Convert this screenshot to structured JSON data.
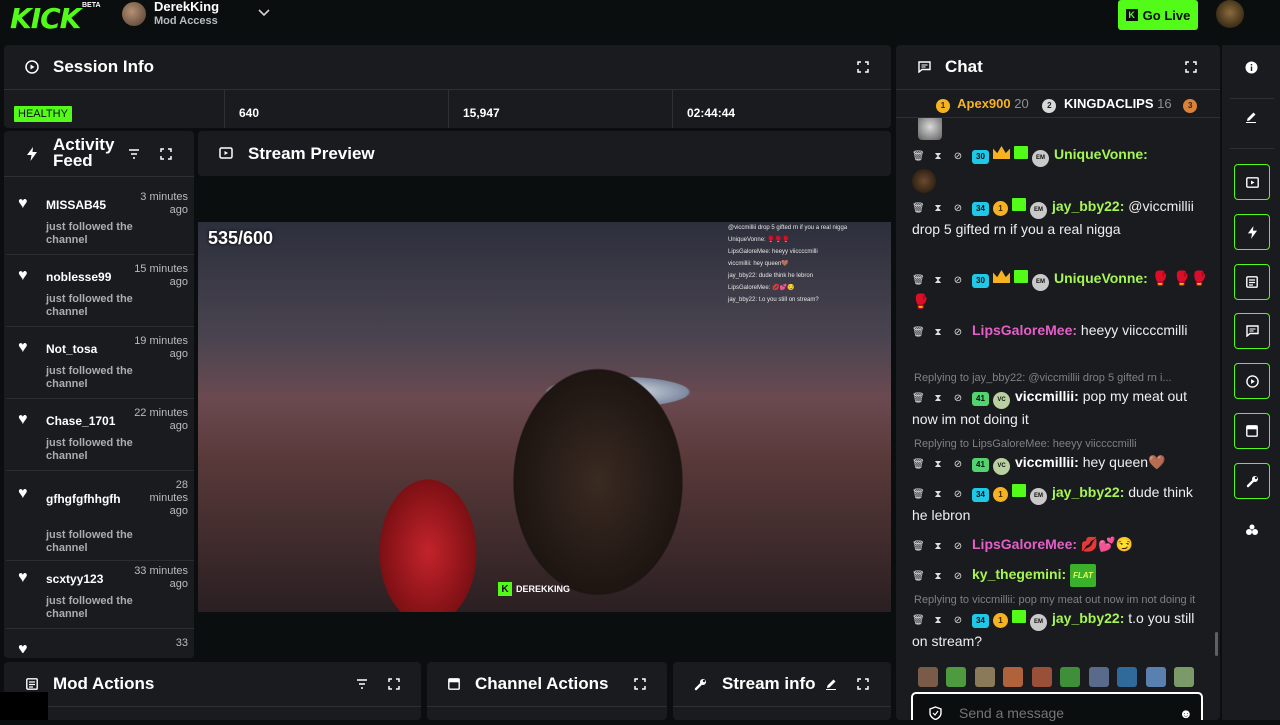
{
  "header": {
    "logo": "KICK",
    "beta": "BETA",
    "username": "DerekKing",
    "role": "Mod Access",
    "go_live": "Go Live",
    "go_live_icon": "K"
  },
  "session": {
    "title": "Session Info",
    "status": "HEALTHY",
    "viewers": "640",
    "followers": "15,947",
    "uptime": "02:44:44"
  },
  "activity": {
    "title": "Activity Feed",
    "items": [
      {
        "name": "MISSAB45",
        "time": "3 minutes ago",
        "action": "just followed the channel"
      },
      {
        "name": "noblesse99",
        "time": "15 minutes ago",
        "action": "just followed the channel"
      },
      {
        "name": "Not_tosa",
        "time": "19 minutes ago",
        "action": "just followed the channel"
      },
      {
        "name": "Chase_1701",
        "time": "22 minutes ago",
        "action": "just followed the channel"
      },
      {
        "name": "gfhgfgfhhgfh",
        "time": "28 minutes ago",
        "action": "just followed the channel"
      },
      {
        "name": "scxtyy123",
        "time": "33 minutes ago",
        "action": "just followed the channel"
      },
      {
        "name": "",
        "time": "33",
        "action": ""
      }
    ]
  },
  "stream": {
    "title": "Stream Preview",
    "count": "535/600",
    "watermark": "DEREKKING",
    "watermark_icon": "K",
    "overlay_lines": [
      "@viccmillii drop 5 gifted rn if you a real nigga",
      "UniqueVonne: 🥊🥊🥊",
      "LipsGaloreMee: heeyy viiccccmilli",
      "viccmillii: pop my meat out now im not doing it",
      "viccmillii: hey queen🤎",
      "jay_bby22: dude think he lebron",
      "LipsGaloreMee: 💋💕😏",
      "ky_thegemini:",
      "jay_bby22: t.o you still on stream?"
    ]
  },
  "chat": {
    "title": "Chat",
    "leaderboard": [
      {
        "rank": "1",
        "name": "Apex900",
        "count": "20"
      },
      {
        "rank": "2",
        "name": "KINGDACLIPS",
        "count": "16"
      },
      {
        "rank": "3",
        "name": "",
        "count": ""
      }
    ],
    "messages": [
      {
        "user": "UniqueVonne:",
        "text": "",
        "sub": "30"
      },
      {
        "user": "jay_bby22:",
        "text": "@viccmillii drop 5 gifted rn if you a real nigga",
        "sub": "34",
        "level": "1"
      },
      {
        "user": "UniqueVonne:",
        "text": "🥊 🥊🥊🥊",
        "sub": "30"
      },
      {
        "user": "LipsGaloreMee:",
        "text": "heeyy viiccccmilli"
      },
      {
        "reply": "Replying to jay_bby22: @viccmillii drop 5 gifted rn i...",
        "user": "viccmillii:",
        "text": "pop my meat out now im not doing it",
        "sub": "41"
      },
      {
        "reply": "Replying to LipsGaloreMee: heeyy viiccccmilli",
        "user": "viccmillii:",
        "text": "hey queen🤎",
        "sub": "41"
      },
      {
        "user": "jay_bby22:",
        "text": "dude think he lebron",
        "sub": "34",
        "level": "1"
      },
      {
        "user": "LipsGaloreMee:",
        "text": "💋💕😏"
      },
      {
        "user": "ky_thegemini:",
        "text": "FLAT"
      },
      {
        "reply": "Replying to viccmillii: pop my meat out now im not doing it",
        "user": "jay_bby22:",
        "text": "t.o you still on stream?",
        "sub": "34",
        "level": "1"
      }
    ],
    "placeholder": "Send a message"
  },
  "bottom": {
    "mod_actions": "Mod Actions",
    "channel_actions": "Channel Actions",
    "stream_info": "Stream info"
  },
  "colors": {
    "accent": "#53fc18",
    "panel": "#191b1f",
    "background": "#0b0e0f",
    "sub_badge": "#1ec8e6",
    "gold": "#f5b322",
    "username_green": "#a6f552",
    "username_pink": "#e65fc8"
  }
}
